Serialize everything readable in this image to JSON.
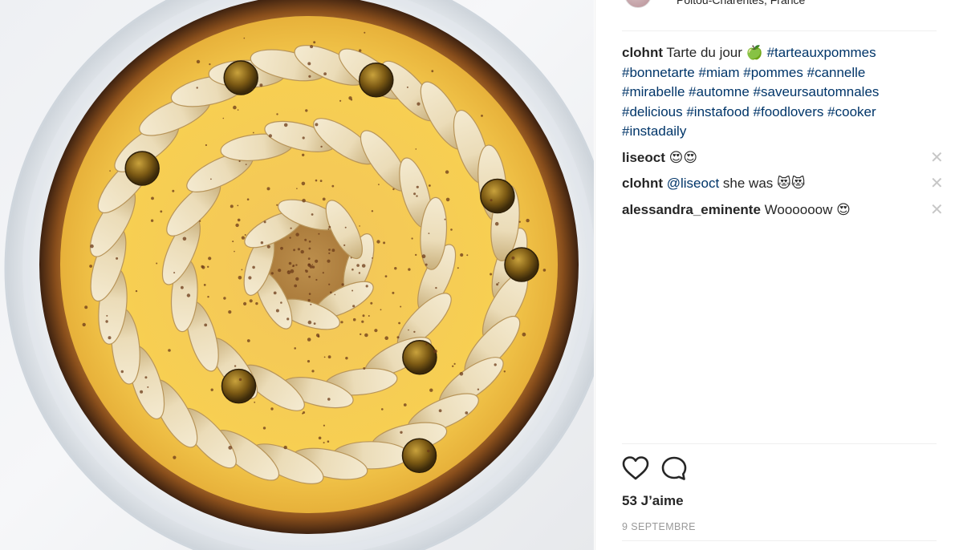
{
  "post": {
    "location": "Poitou-Charentes, France",
    "photo_icon": "apple-tart-photo"
  },
  "comments": [
    {
      "user": "clohnt",
      "parts": [
        {
          "type": "text",
          "value": "Tarte du jour "
        },
        {
          "type": "emoji",
          "value": "🍏"
        },
        {
          "type": "text",
          "value": " "
        },
        {
          "type": "tag",
          "value": "#tarteauxpommes"
        },
        {
          "type": "text",
          "value": " "
        },
        {
          "type": "tag",
          "value": "#bonnetarte"
        },
        {
          "type": "text",
          "value": " "
        },
        {
          "type": "tag",
          "value": "#miam"
        },
        {
          "type": "text",
          "value": " "
        },
        {
          "type": "tag",
          "value": "#pommes"
        },
        {
          "type": "text",
          "value": " "
        },
        {
          "type": "tag",
          "value": "#cannelle"
        },
        {
          "type": "text",
          "value": " "
        },
        {
          "type": "tag",
          "value": "#mirabelle"
        },
        {
          "type": "text",
          "value": " "
        },
        {
          "type": "tag",
          "value": "#automne"
        },
        {
          "type": "text",
          "value": " "
        },
        {
          "type": "tag",
          "value": "#saveursautomnales"
        },
        {
          "type": "text",
          "value": " "
        },
        {
          "type": "tag",
          "value": "#delicious"
        },
        {
          "type": "text",
          "value": " "
        },
        {
          "type": "tag",
          "value": "#instafood"
        },
        {
          "type": "text",
          "value": " "
        },
        {
          "type": "tag",
          "value": "#foodlovers"
        },
        {
          "type": "text",
          "value": " "
        },
        {
          "type": "tag",
          "value": "#cooker"
        },
        {
          "type": "text",
          "value": " "
        },
        {
          "type": "tag",
          "value": "#instadaily"
        }
      ],
      "deletable": false
    },
    {
      "user": "liseoct",
      "parts": [
        {
          "type": "emoji",
          "value": "😍😍"
        }
      ],
      "deletable": true
    },
    {
      "user": "clohnt",
      "parts": [
        {
          "type": "tag",
          "value": "@liseoct"
        },
        {
          "type": "text",
          "value": " she was "
        },
        {
          "type": "emoji",
          "value": "😻😻"
        }
      ],
      "deletable": true
    },
    {
      "user": "alessandra_eminente",
      "parts": [
        {
          "type": "text",
          "value": "Woooooow "
        },
        {
          "type": "emoji",
          "value": "😍"
        }
      ],
      "deletable": true
    }
  ],
  "delete_glyph": "✕",
  "actions": {
    "like_icon": "heart-icon",
    "comment_icon": "speech-bubble-icon",
    "likes_text": "53 J’aime",
    "date_text": "9 SEPTEMBRE"
  },
  "colors": {
    "link": "#003569",
    "text": "#262626",
    "muted": "#999999",
    "divider": "#efefef"
  }
}
